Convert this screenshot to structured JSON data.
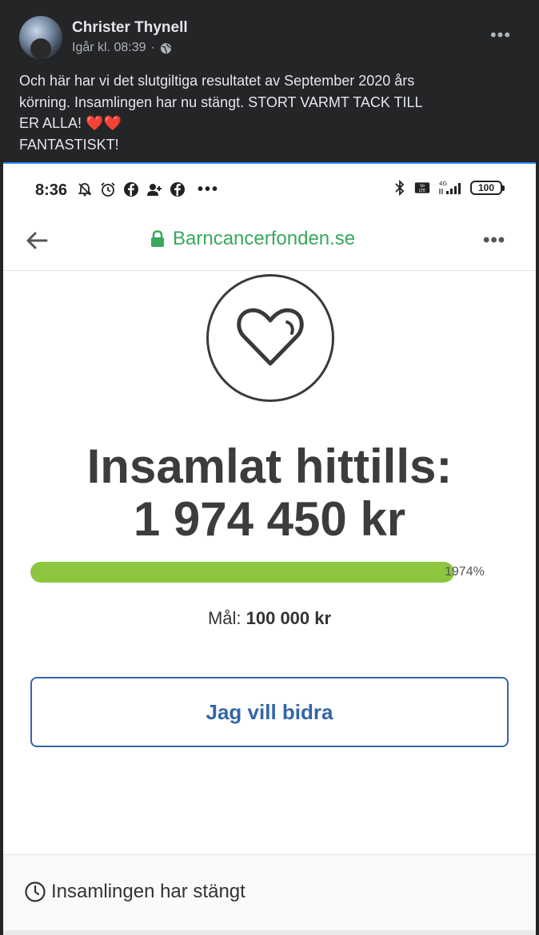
{
  "post": {
    "author": "Christer Thynell",
    "timestamp": "Igår kl. 08:39",
    "separator": "·",
    "privacy_icon": "globe-icon",
    "more_icon": "more-horizontal-icon",
    "more_glyph": "•••",
    "text_lines": [
      "Och här har vi det slutgiltiga resultatet av September 2020 års",
      "körning. Insamlingen har nu stängt. STORT VARMT TACK TILL",
      "ER ALLA! ❤️❤️",
      "FANTASTISKT!"
    ]
  },
  "phone": {
    "status_bar": {
      "time": "8:36",
      "left_icons": [
        "notifications-off-icon",
        "alarm-icon",
        "facebook-icon",
        "person-add-icon",
        "facebook-icon"
      ],
      "overflow": "•••",
      "right_icons": [
        "bluetooth-icon",
        "volte-icon",
        "signal-4g-icon"
      ],
      "network": "4G",
      "volte": "Vo LTE",
      "battery": "100"
    },
    "browser": {
      "back_icon": "arrow-left-icon",
      "lock_icon": "lock-icon",
      "url": "Barncancerfonden.se",
      "menu_glyph": "•••"
    },
    "page": {
      "heart_icon": "heart-icon",
      "headline": "Insamlat hittills:",
      "amount": "1 974 450 kr",
      "progress_label": "1974%",
      "progress_fraction": 1.0,
      "goal_label": "Mål:",
      "goal_value": "100 000 kr",
      "cta_label": "Jag vill bidra",
      "closed_icon": "clock-icon",
      "closed_text": "Insamlingen har stängt"
    },
    "colors": {
      "url_green": "#3aa85c",
      "progress_green": "#8cc63f",
      "cta_blue": "#3366a8"
    }
  }
}
